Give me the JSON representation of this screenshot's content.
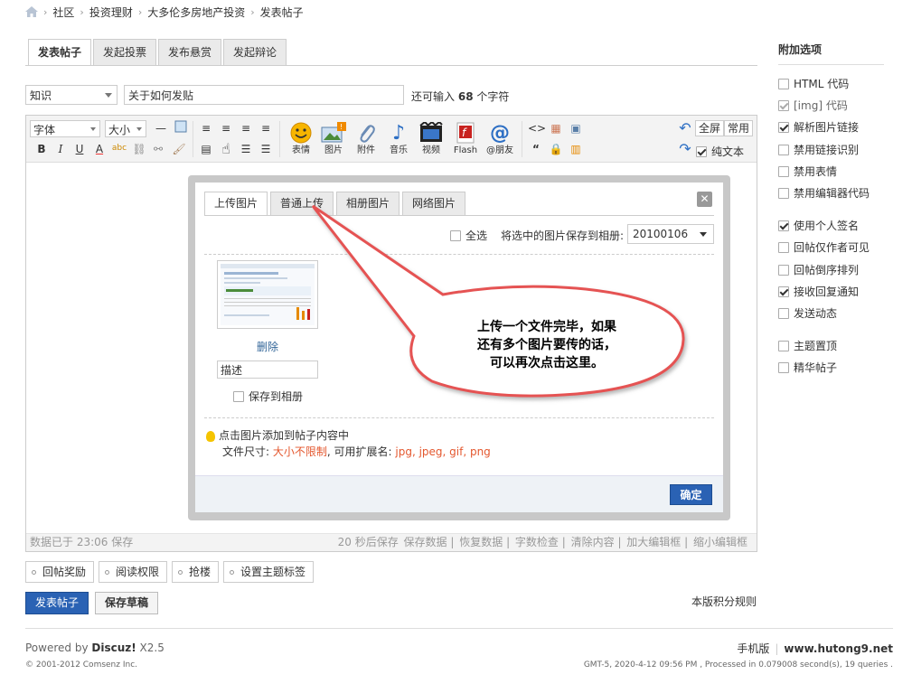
{
  "breadcrumb": {
    "items": [
      "社区",
      "投资理财",
      "大多伦多房地产投资",
      "发表帖子"
    ]
  },
  "tabs": [
    "发表帖子",
    "发起投票",
    "发布悬赏",
    "发起辩论"
  ],
  "subject": {
    "type_value": "知识",
    "title_value": "关于如何发贴",
    "remain_prefix": "还可输入",
    "remain_count": "68",
    "remain_suffix": "个字符"
  },
  "toolbar": {
    "font_label": "字体",
    "size_label": "大小",
    "big_buttons": [
      "表情",
      "图片",
      "附件",
      "音乐",
      "视频",
      "Flash",
      "@朋友"
    ],
    "fullscreen": "全屏",
    "common": "常用",
    "plain_text": "纯文本"
  },
  "editor_status": {
    "left": "数据已于 23:06 保存",
    "right": [
      "20 秒后保存",
      "保存数据",
      "恢复数据",
      "字数检查",
      "清除内容",
      "加大编辑框",
      "缩小编辑框"
    ]
  },
  "dialog": {
    "tabs": [
      "上传图片",
      "普通上传",
      "相册图片",
      "网络图片"
    ],
    "select_all": "全选",
    "save_to_label": "将选中的图片保存到相册:",
    "album_value": "20100106",
    "delete_label": "删除",
    "desc_value": "描述",
    "save_album_label": "保存到相册",
    "tip_line1": "点击图片添加到帖子内容中",
    "tip_size_label": "文件尺寸: ",
    "tip_size_value": "大小不限制",
    "tip_ext_label": ", 可用扩展名: ",
    "tip_ext_value": "jpg, jpeg, gif, png",
    "confirm": "确定"
  },
  "callout": {
    "line1": "上传一个文件完毕，如果",
    "line2": "还有多个图片要传的话，",
    "line3": "可以再次点击这里。"
  },
  "options": [
    "回帖奖励",
    "阅读权限",
    "抢楼",
    "设置主题标签"
  ],
  "buttons": {
    "post": "发表帖子",
    "draft": "保存草稿",
    "rules": "本版积分规则"
  },
  "sidebar": {
    "title": "附加选项",
    "items": [
      {
        "label": "HTML 代码",
        "checked": false
      },
      {
        "label": "[img] 代码",
        "checked": true
      },
      {
        "label": "解析图片链接",
        "checked": true
      },
      {
        "label": "禁用链接识别",
        "checked": false
      },
      {
        "label": "禁用表情",
        "checked": false
      },
      {
        "label": "禁用编辑器代码",
        "checked": false
      },
      {
        "label": "使用个人签名",
        "checked": true
      },
      {
        "label": "回帖仅作者可见",
        "checked": false
      },
      {
        "label": "回帖倒序排列",
        "checked": false
      },
      {
        "label": "接收回复通知",
        "checked": true
      },
      {
        "label": "发送动态",
        "checked": false
      },
      {
        "label": "主题置顶",
        "checked": false
      },
      {
        "label": "精华帖子",
        "checked": false
      }
    ]
  },
  "footer": {
    "powered_prefix": "Powered by ",
    "powered_brand": "Discuz!",
    "powered_version": " X2.5",
    "copyright": "© 2001-2012 Comsenz Inc.",
    "mobile": "手机版",
    "site": "www.hutong9.net",
    "gmt": "GMT-5, 2020-4-12 09:56 PM , Processed in 0.079008 second(s), 19 queries ."
  }
}
